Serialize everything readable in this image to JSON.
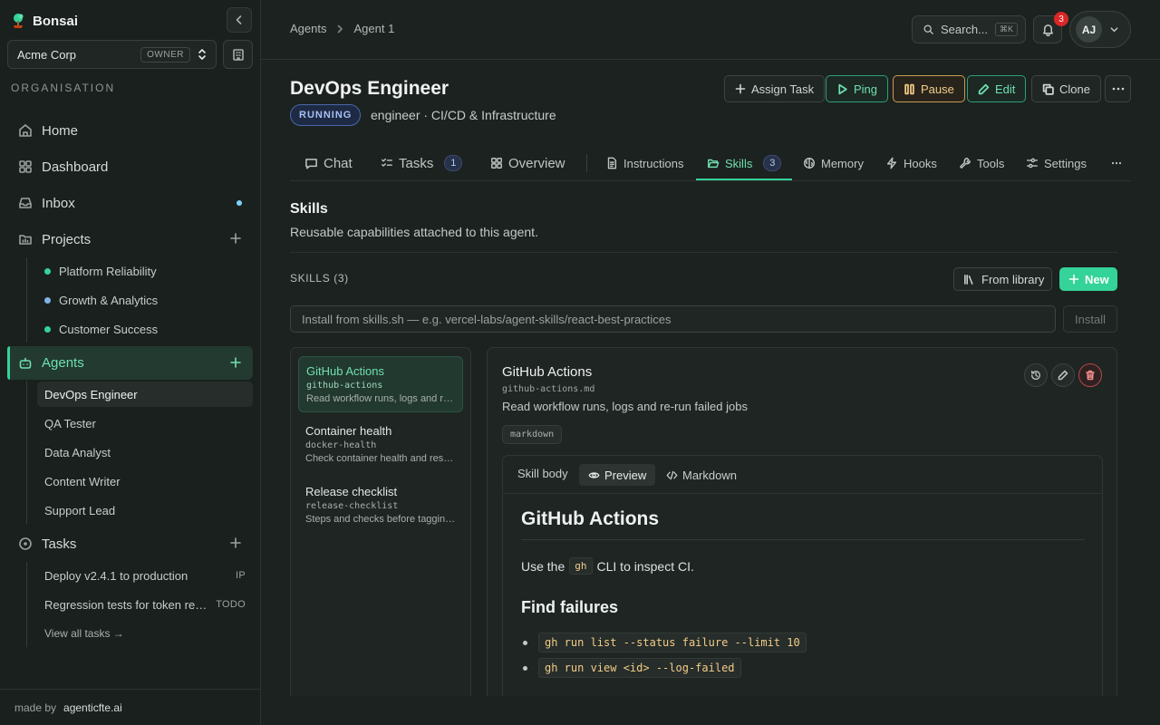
{
  "sidebar": {
    "brand": "Bonsai",
    "org": {
      "name": "Acme Corp",
      "role": "OWNER"
    },
    "section_label": "ORGANISATION",
    "nav": {
      "home": "Home",
      "dashboard": "Dashboard",
      "inbox": "Inbox",
      "projects": "Projects",
      "agents": "Agents",
      "tasks": "Tasks"
    },
    "projects": [
      {
        "name": "Platform Reliability",
        "color": "#34d399"
      },
      {
        "name": "Growth & Analytics",
        "color": "#7fb2e5"
      },
      {
        "name": "Customer Success",
        "color": "#34d399"
      }
    ],
    "agents": [
      "DevOps Engineer",
      "QA Tester",
      "Data Analyst",
      "Content Writer",
      "Support Lead"
    ],
    "tasks": [
      {
        "title": "Deploy v2.4.1 to production",
        "status": "IP"
      },
      {
        "title": "Regression tests for token refresh",
        "status": "TODO"
      }
    ],
    "view_all": "View all tasks →",
    "made_by": {
      "prefix": "made by",
      "name": "agenticfte.ai"
    }
  },
  "topbar": {
    "breadcrumb": [
      "Agents",
      "Agent 1"
    ],
    "search_label": "Search...",
    "search_kbd": "⌘K",
    "notifications": "3",
    "user_initials": "AJ"
  },
  "agent": {
    "name": "DevOps Engineer",
    "status": "RUNNING",
    "subtitle": "engineer · CI/CD & Infrastructure",
    "actions": {
      "assign": "Assign Task",
      "ping": "Ping",
      "pause": "Pause",
      "edit": "Edit",
      "clone": "Clone"
    }
  },
  "tabs": {
    "chat": "Chat",
    "tasks": "Tasks",
    "tasks_count": "1",
    "overview": "Overview",
    "instructions": "Instructions",
    "skills": "Skills",
    "skills_count": "3",
    "memory": "Memory",
    "hooks": "Hooks",
    "tools": "Tools",
    "settings": "Settings"
  },
  "skills": {
    "title": "Skills",
    "description": "Reusable capabilities attached to this agent.",
    "count_label": "SKILLS (3)",
    "from_library": "From library",
    "new": "New",
    "install_placeholder": "Install from skills.sh — e.g. vercel-labs/agent-skills/react-best-practices",
    "install_button": "Install",
    "list": [
      {
        "name": "GitHub Actions",
        "file": "github-actions",
        "desc": "Read workflow runs, logs and re-run failed jobs"
      },
      {
        "name": "Container health",
        "file": "docker-health",
        "desc": "Check container health and restart unhealthy ones"
      },
      {
        "name": "Release checklist",
        "file": "release-checklist",
        "desc": "Steps and checks before tagging a release"
      }
    ]
  },
  "detail": {
    "title": "GitHub Actions",
    "file": "github-actions.md",
    "desc": "Read workflow runs, logs and re-run failed jobs",
    "tag": "markdown",
    "body_label": "Skill body",
    "preview_tab": "Preview",
    "markdown_tab": "Markdown",
    "md": {
      "h1": "GitHub Actions",
      "p_before": "Use the",
      "p_code": "gh",
      "p_after": "CLI to inspect CI.",
      "h2": "Find failures",
      "items": [
        "gh run list --status failure --limit 10",
        "gh run view <id> --log-failed"
      ]
    }
  }
}
